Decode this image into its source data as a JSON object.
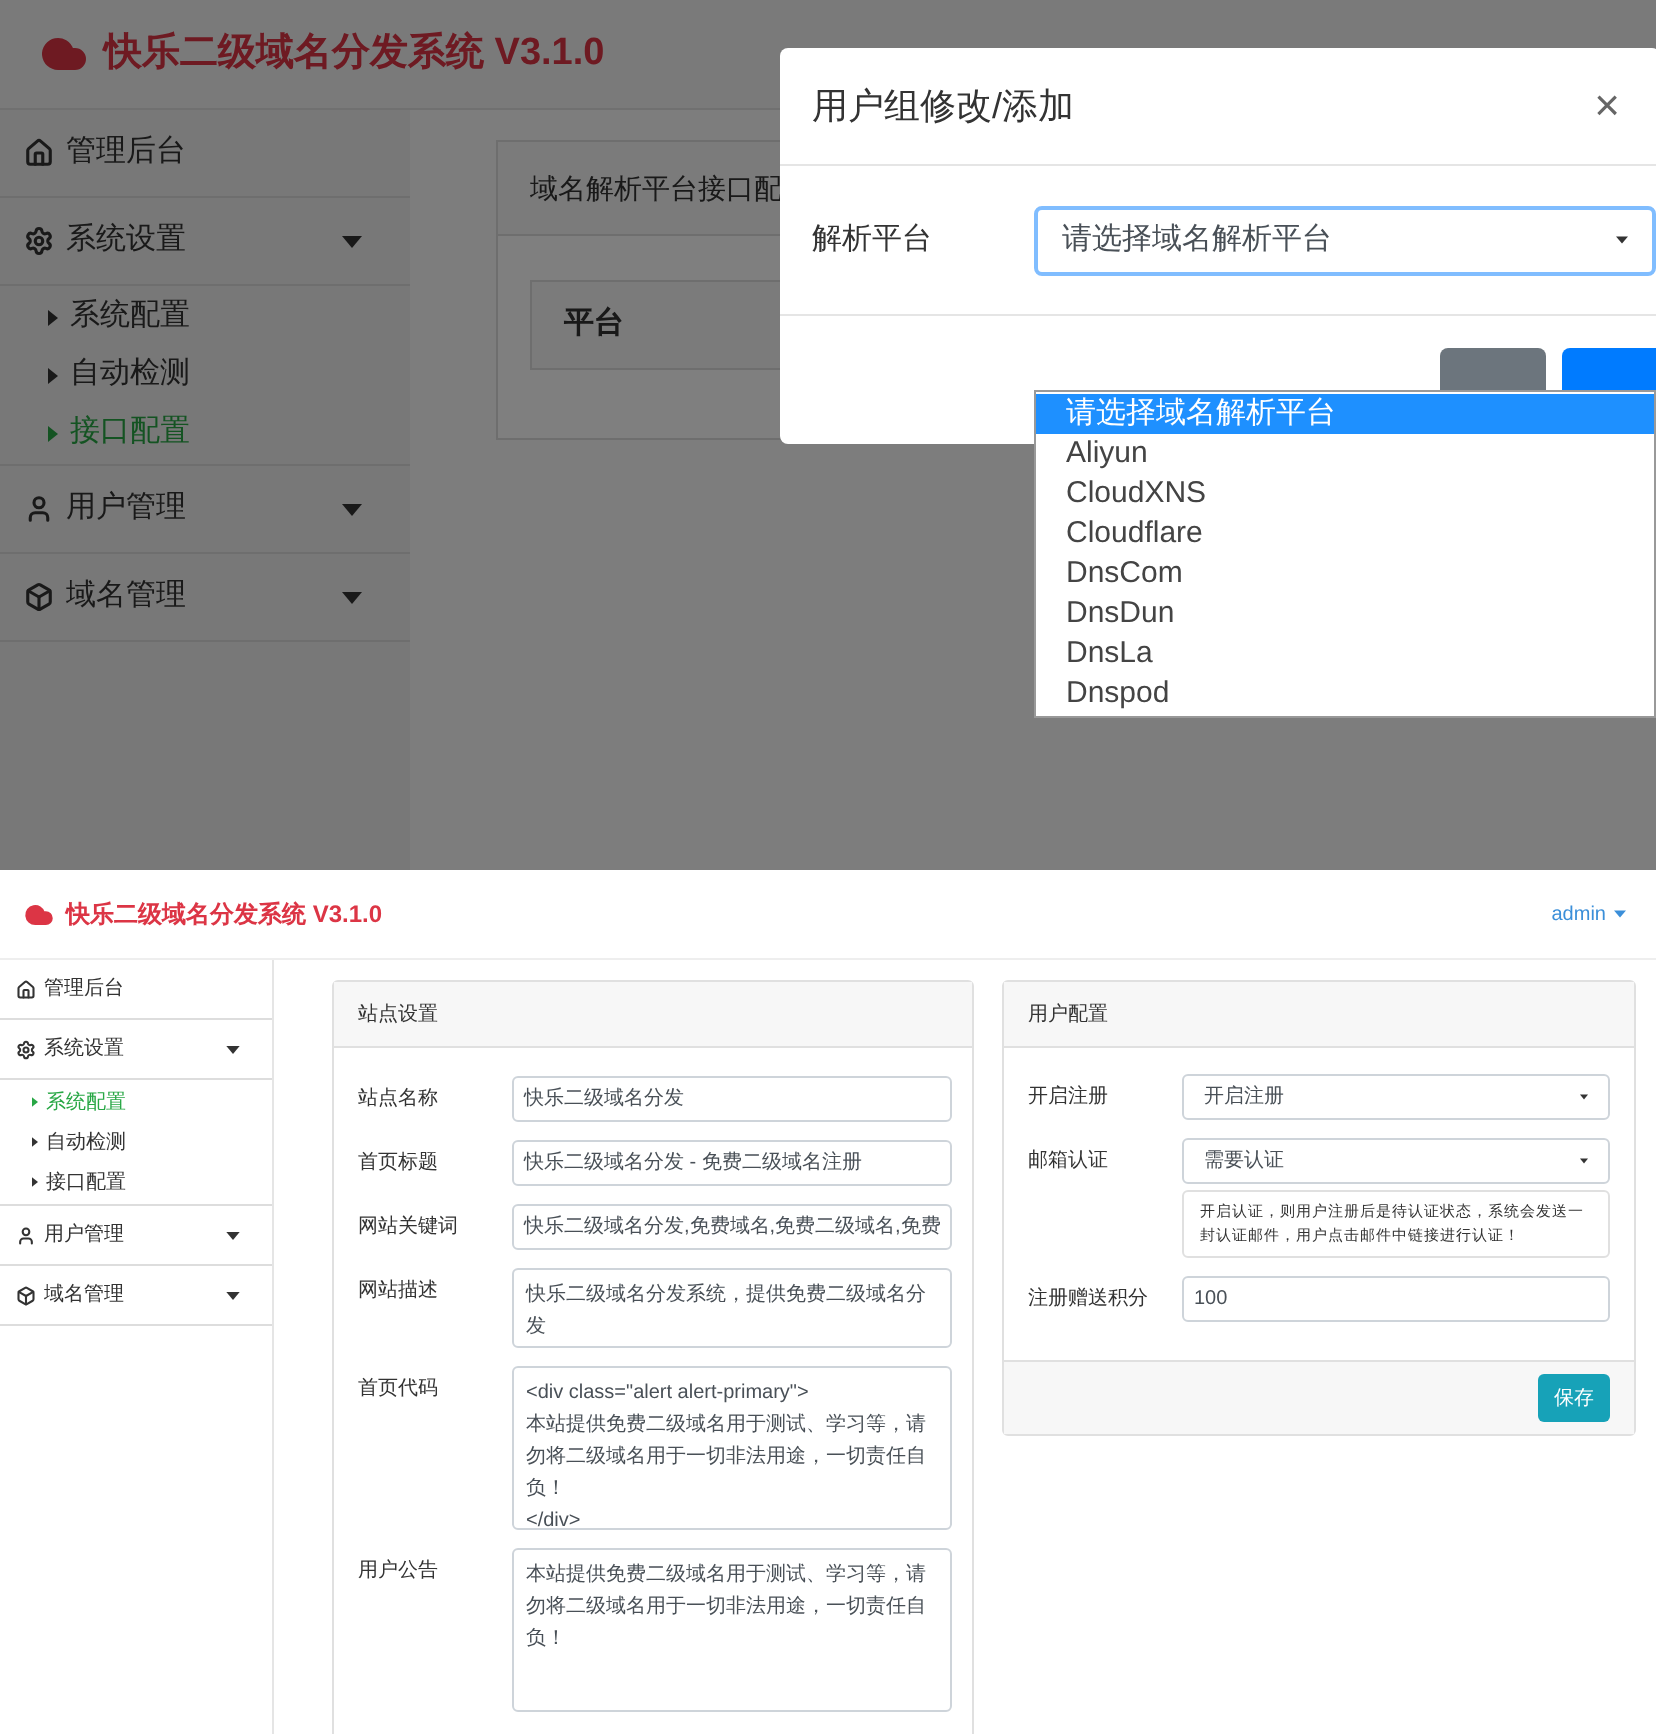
{
  "top": {
    "app_title": "快乐二级域名分发系统 V3.1.0",
    "sidebar": [
      {
        "label": "管理后台",
        "kind": "link"
      },
      {
        "label": "系统设置",
        "kind": "group",
        "children": [
          {
            "label": "系统配置",
            "selected": false
          },
          {
            "label": "自动检测",
            "selected": false
          },
          {
            "label": "接口配置",
            "selected": true
          }
        ]
      },
      {
        "label": "用户管理",
        "kind": "group"
      },
      {
        "label": "域名管理",
        "kind": "group"
      }
    ],
    "card_title": "域名解析平台接口配",
    "table": {
      "columns": [
        "平台"
      ]
    },
    "modal": {
      "title": "用户组修改/添加",
      "close": "×",
      "field": {
        "label": "解析平台",
        "value": "请选择域名解析平台"
      },
      "buttons": [
        {
          "kind": "secondary"
        },
        {
          "kind": "primary"
        }
      ],
      "options": [
        {
          "label": "请选择域名解析平台",
          "selected": true
        },
        {
          "label": "Aliyun",
          "selected": false
        },
        {
          "label": "CloudXNS",
          "selected": false
        },
        {
          "label": "Cloudflare",
          "selected": false
        },
        {
          "label": "DnsCom",
          "selected": false
        },
        {
          "label": "DnsDun",
          "selected": false
        },
        {
          "label": "DnsLa",
          "selected": false
        },
        {
          "label": "Dnspod",
          "selected": false
        }
      ]
    }
  },
  "bottom": {
    "app_title": "快乐二级域名分发系统 V3.1.0",
    "user_menu": "admin",
    "sidebar": [
      {
        "label": "管理后台",
        "kind": "link"
      },
      {
        "label": "系统设置",
        "kind": "group",
        "children": [
          {
            "label": "系统配置",
            "selected": true
          },
          {
            "label": "自动检测",
            "selected": false
          },
          {
            "label": "接口配置",
            "selected": false
          }
        ]
      },
      {
        "label": "用户管理",
        "kind": "group"
      },
      {
        "label": "域名管理",
        "kind": "group"
      }
    ],
    "site_settings": {
      "title": "站点设置",
      "fields": [
        {
          "label": "站点名称",
          "kind": "input",
          "value": "快乐二级域名分发"
        },
        {
          "label": "首页标题",
          "kind": "input",
          "value": "快乐二级域名分发 - 免费二级域名注册"
        },
        {
          "label": "网站关键词",
          "kind": "input",
          "value": "快乐二级域名分发,免费域名,免费二级域名,免费"
        },
        {
          "label": "网站描述",
          "kind": "textarea",
          "value": "快乐二级域名分发系统，提供免费二级域名分发"
        },
        {
          "label": "首页代码",
          "kind": "memo",
          "value": "<div class=\"alert alert-primary\">\n本站提供免费二级域名用于测试、学习等，请勿将二级域名用于一切非法用途，一切责任自负！\n</div>"
        },
        {
          "label": "用户公告",
          "kind": "memo",
          "value": "本站提供免费二级域名用于测试、学习等，请勿将二级域名用于一切非法用途，一切责任自负！"
        }
      ]
    },
    "user_settings": {
      "title": "用户配置",
      "fields": [
        {
          "label": "开启注册",
          "kind": "select",
          "value": "开启注册"
        },
        {
          "label": "邮箱认证",
          "kind": "select",
          "value": "需要认证",
          "help": "开启认证，则用户注册后是待认证状态，系统会发送一封认证邮件，用户点击邮件中链接进行认证！"
        },
        {
          "label": "注册赠送积分",
          "kind": "input",
          "value": "100"
        }
      ],
      "button": "保存"
    }
  }
}
